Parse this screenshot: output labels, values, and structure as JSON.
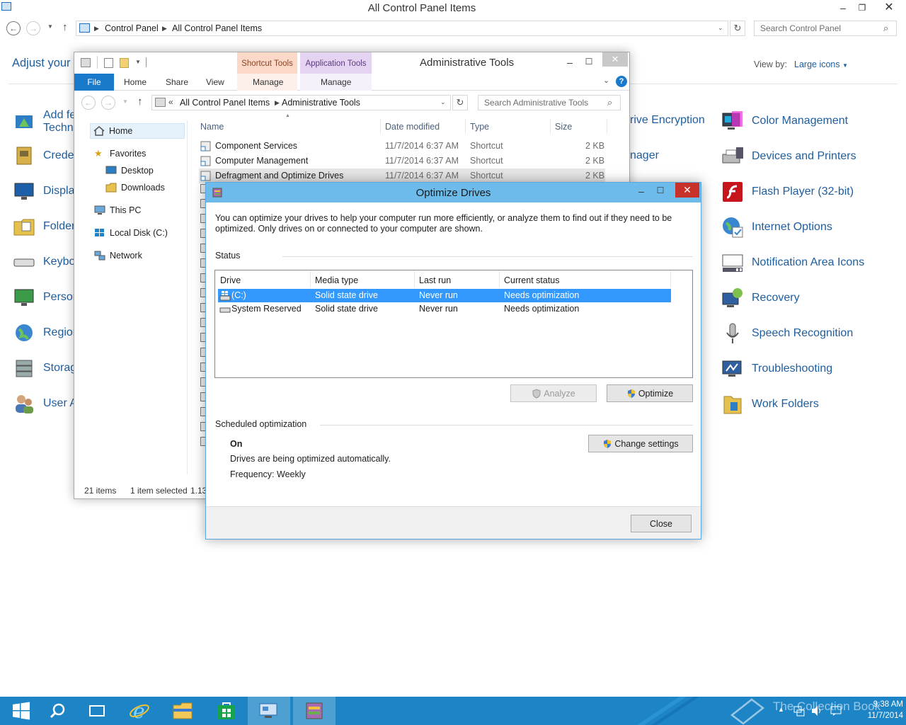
{
  "control_panel": {
    "title": "All Control Panel Items",
    "breadcrumb": [
      "Control Panel",
      "All Control Panel Items"
    ],
    "search_placeholder": "Search Control Panel",
    "heading": "Adjust your c",
    "view_by_label": "View by:",
    "view_by_value": "Large icons",
    "left_items": [
      "Add fe",
      "Techni",
      "Crede",
      "Displa",
      "Folder",
      "Keybo",
      "Persor",
      "Regior",
      "Storag",
      "User A"
    ],
    "mid_items": [
      "rive Encryption",
      "nager"
    ],
    "right_items": [
      "Color Management",
      "Devices and Printers",
      "Flash Player (32-bit)",
      "Internet Options",
      "Notification Area Icons",
      "Recovery",
      "Speech Recognition",
      "Troubleshooting",
      "Work Folders"
    ]
  },
  "admin_tools": {
    "title": "Administrative Tools",
    "context_tabs": {
      "shortcut": "Shortcut Tools",
      "application": "Application Tools"
    },
    "ribbon_tabs": [
      "File",
      "Home",
      "Share",
      "View",
      "Manage",
      "Manage"
    ],
    "breadcrumb": [
      "All Control Panel Items",
      "Administrative Tools"
    ],
    "search_placeholder": "Search Administrative Tools",
    "nav": {
      "home": "Home",
      "favorites": "Favorites",
      "desktop": "Desktop",
      "downloads": "Downloads",
      "this_pc": "This PC",
      "local_disk": "Local Disk (C:)",
      "network": "Network"
    },
    "columns": [
      "Name",
      "Date modified",
      "Type",
      "Size"
    ],
    "files": [
      {
        "name": "Component Services",
        "date": "11/7/2014 6:37 AM",
        "type": "Shortcut",
        "size": "2 KB"
      },
      {
        "name": "Computer Management",
        "date": "11/7/2014 6:37 AM",
        "type": "Shortcut",
        "size": "2 KB"
      },
      {
        "name": "Defragment and Optimize Drives",
        "date": "11/7/2014 6:37 AM",
        "type": "Shortcut",
        "size": "2 KB"
      }
    ],
    "status": {
      "items": "21 items",
      "selected": "1 item selected",
      "size": "1.13"
    }
  },
  "optimize_drives": {
    "title": "Optimize Drives",
    "description": "You can optimize your drives to help your computer run more efficiently, or analyze them to find out if they need to be optimized. Only drives on or connected to your computer are shown.",
    "status_label": "Status",
    "columns": [
      "Drive",
      "Media type",
      "Last run",
      "Current status"
    ],
    "drives": [
      {
        "drive": "(C:)",
        "media": "Solid state drive",
        "last_run": "Never run",
        "status": "Needs optimization"
      },
      {
        "drive": "System Reserved",
        "media": "Solid state drive",
        "last_run": "Never run",
        "status": "Needs optimization"
      }
    ],
    "analyze_label": "Analyze",
    "optimize_label": "Optimize",
    "scheduled_label": "Scheduled optimization",
    "scheduled_state": "On",
    "scheduled_desc": "Drives are being optimized automatically.",
    "frequency": "Frequency: Weekly",
    "change_settings_label": "Change settings",
    "close_label": "Close"
  },
  "taskbar": {
    "time": "9:38 AM",
    "date": "11/7/2014",
    "watermark": "The Collection Book"
  },
  "colors": {
    "taskbar": "#1d84c6",
    "dialog_title": "#6dbbea",
    "selection": "#3399ff",
    "link": "#1e5d9e",
    "file_tab": "#1979ca"
  }
}
